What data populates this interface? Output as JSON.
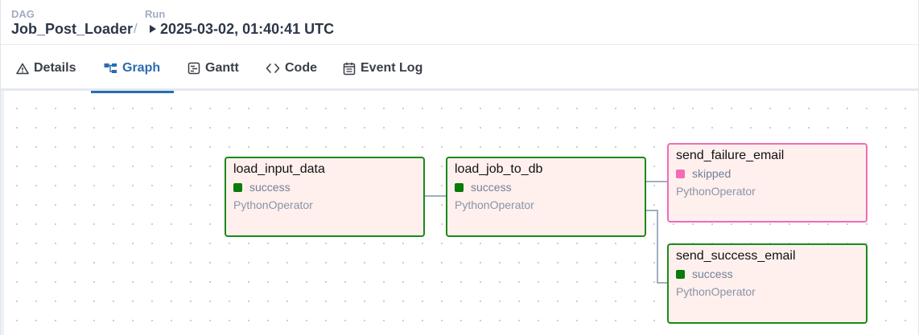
{
  "breadcrumb": {
    "dag_label": "DAG",
    "dag_name": "Job_Post_Loader",
    "separator": "/",
    "run_label": "Run",
    "run_value": "2025-03-02, 01:40:41 UTC"
  },
  "tabs": [
    {
      "label": "Details",
      "icon": "warning-triangle-icon"
    },
    {
      "label": "Graph",
      "icon": "graph-icon",
      "active": true
    },
    {
      "label": "Gantt",
      "icon": "gantt-icon"
    },
    {
      "label": "Code",
      "icon": "code-icon"
    },
    {
      "label": "Event Log",
      "icon": "event-log-icon"
    }
  ],
  "colors": {
    "success": "#0a7a0a",
    "skipped": "#f46ab6",
    "accent": "#2b6cb0"
  },
  "graph": {
    "tasks": [
      {
        "id": "load_input_data",
        "state": "success",
        "operator": "PythonOperator"
      },
      {
        "id": "load_job_to_db",
        "state": "success",
        "operator": "PythonOperator"
      },
      {
        "id": "send_failure_email",
        "state": "skipped",
        "operator": "PythonOperator"
      },
      {
        "id": "send_success_email",
        "state": "success",
        "operator": "PythonOperator"
      }
    ]
  }
}
